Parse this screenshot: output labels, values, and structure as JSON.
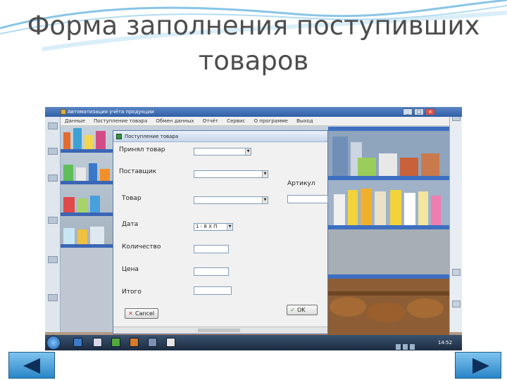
{
  "slide": {
    "title": "Форма заполнения поступивших товаров"
  },
  "app": {
    "title": "Автоматизация учёта продукции",
    "menu": [
      "Данные",
      "Поступление товара",
      "Обмен данных",
      "Отчёт",
      "Сервис",
      "О программе",
      "Выход"
    ],
    "window_buttons": [
      "_",
      "□",
      "×"
    ]
  },
  "dialog": {
    "title": "Поступление товара",
    "fields": {
      "accepted_label": "Принял товар",
      "supplier_label": "Поставщик",
      "article_label": "Артикул",
      "product_label": "Товар",
      "date_label": "Дата",
      "date_value": "1 - 8 Х П",
      "quantity_label": "Количество",
      "price_label": "Цена",
      "total_label": "Итого"
    },
    "cancel_label": "Cancel",
    "ok_label": "OK"
  },
  "taskbar": {
    "clock": "14:52",
    "icon_colors": [
      "#3c7ac9",
      "#d8d8e8",
      "#53a83a",
      "#d97a2b",
      "#7c8fb3",
      "#e5e5e5"
    ]
  },
  "navigation": {
    "prev_icon": "triangle-left-icon",
    "next_icon": "triangle-right-icon"
  }
}
